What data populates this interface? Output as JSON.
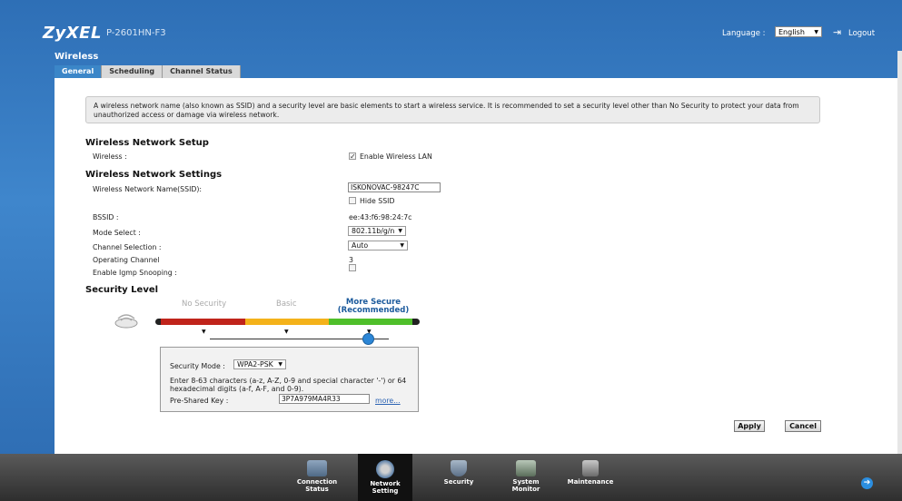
{
  "header": {
    "brand": "ZyXEL",
    "model": "P-2601HN-F3",
    "language_label": "Language :",
    "language_value": "English",
    "logout": "Logout"
  },
  "page": {
    "title": "Wireless",
    "tabs": [
      {
        "label": "General",
        "active": true
      },
      {
        "label": "Scheduling",
        "active": false
      },
      {
        "label": "Channel Status",
        "active": false
      }
    ],
    "info_text": "A wireless network name (also known as SSID) and a security level are basic elements to start a wireless service. It is recommended to set a security level other than No Security to protect your data from unauthorized access or damage via wireless network."
  },
  "setup": {
    "heading": "Wireless Network Setup",
    "wireless_label": "Wireless :",
    "enable_label": "Enable Wireless LAN",
    "enable_checked": true
  },
  "settings": {
    "heading": "Wireless Network Settings",
    "ssid_label": "Wireless Network Name(SSID):",
    "ssid_value": "ISKONOVAC-98247C",
    "hide_ssid_label": "Hide SSID",
    "hide_ssid_checked": false,
    "bssid_label": "BSSID :",
    "bssid_value": "ee:43:f6:98:24:7c",
    "mode_label": "Mode Select :",
    "mode_value": "802.11b/g/n",
    "channel_label": "Channel Selection :",
    "channel_value": "Auto",
    "operating_label": "Operating Channel",
    "operating_value": "3",
    "igmp_label": "Enable Igmp Snooping :",
    "igmp_checked": false
  },
  "security": {
    "heading": "Security Level",
    "levels": [
      "No Security",
      "Basic",
      "More Secure\n(Recommended)"
    ],
    "level_selected_line1": "More Secure",
    "level_selected_line2": "(Recommended)",
    "colors": {
      "red": "#c0241b",
      "yellow": "#f4b21a",
      "green": "#4fbf2a"
    },
    "mode_label": "Security Mode :",
    "mode_value": "WPA2-PSK",
    "hint": "Enter 8-63 characters (a-z, A-Z, 0-9 and special character '-') or 64 hexadecimal digits (a-f, A-F, and 0-9).",
    "psk_label": "Pre-Shared Key :",
    "psk_value": "3P7A979MA4R33",
    "more_link": "more..."
  },
  "actions": {
    "apply": "Apply",
    "cancel": "Cancel"
  },
  "dock": {
    "items": [
      {
        "line1": "Connection",
        "line2": "Status",
        "icon": "connection-status-icon"
      },
      {
        "line1": "Network",
        "line2": "Setting",
        "icon": "network-setting-icon",
        "active": true
      },
      {
        "line1": "Security",
        "line2": "",
        "icon": "security-icon"
      },
      {
        "line1": "System",
        "line2": "Monitor",
        "icon": "system-monitor-icon"
      },
      {
        "line1": "Maintenance",
        "line2": "",
        "icon": "maintenance-icon"
      }
    ]
  }
}
